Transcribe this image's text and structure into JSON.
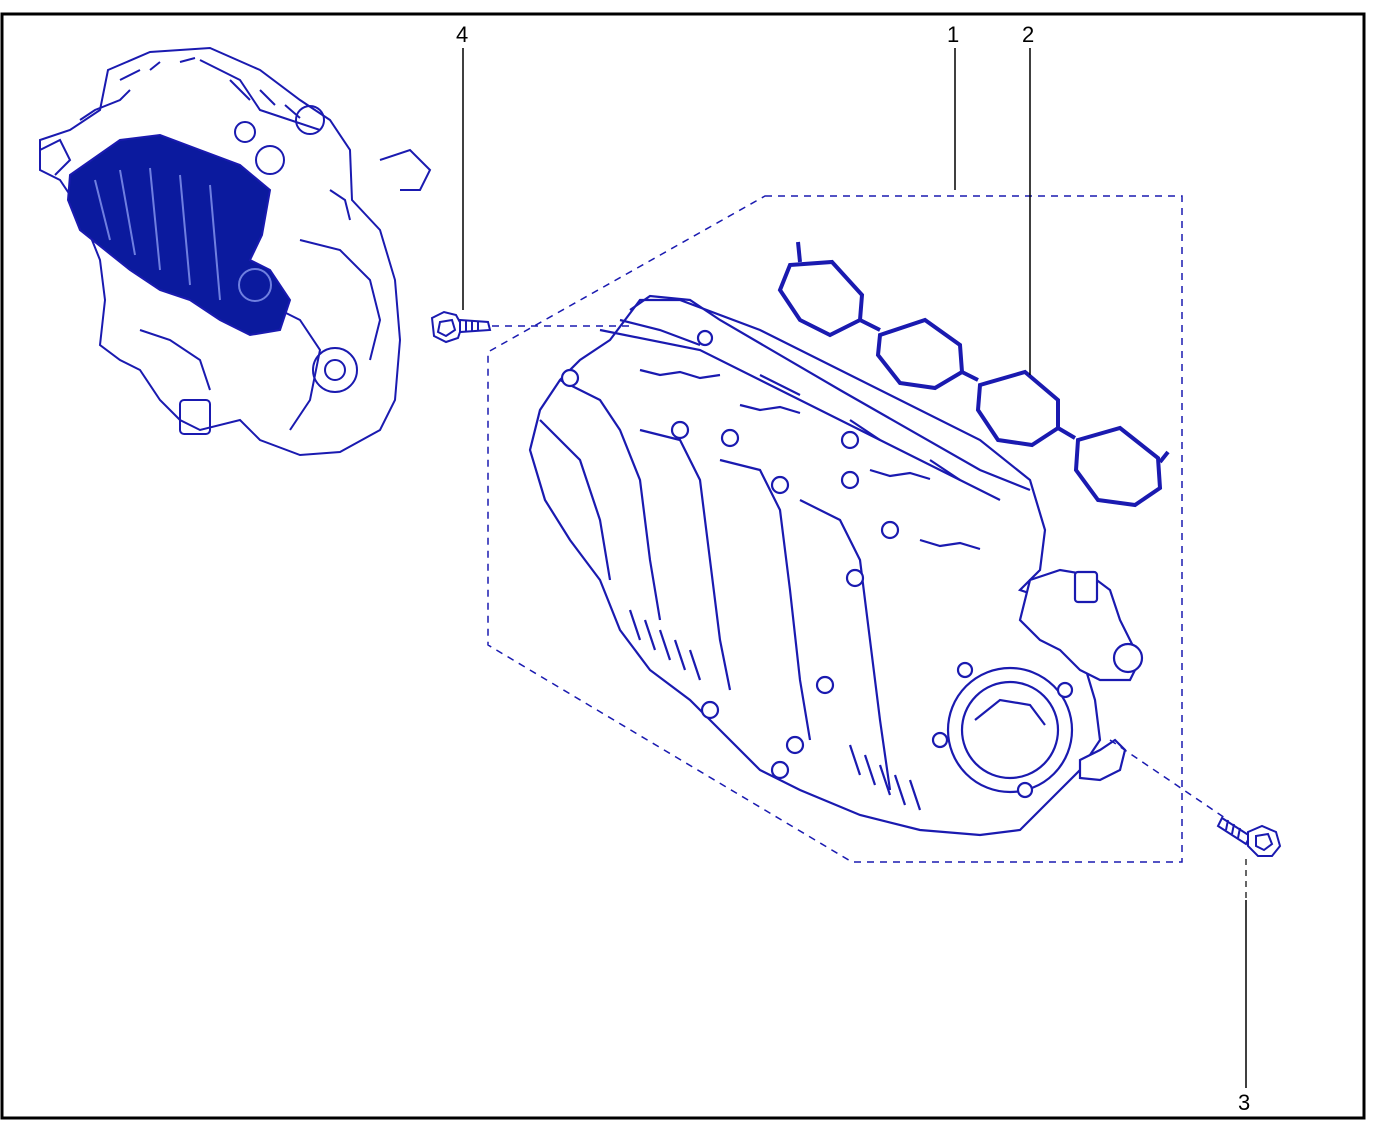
{
  "diagram": {
    "callouts": {
      "part_1": "1",
      "part_2": "2",
      "part_3": "3",
      "part_4": "4"
    },
    "colors": {
      "line": "#1a1ab0",
      "fill_highlight": "#0b1a9e",
      "leader": "#000000",
      "frame": "#000000"
    },
    "icons": [
      "engine-assembly-icon",
      "intake-manifold-icon",
      "manifold-gasket-icon",
      "bolt-icon"
    ]
  }
}
